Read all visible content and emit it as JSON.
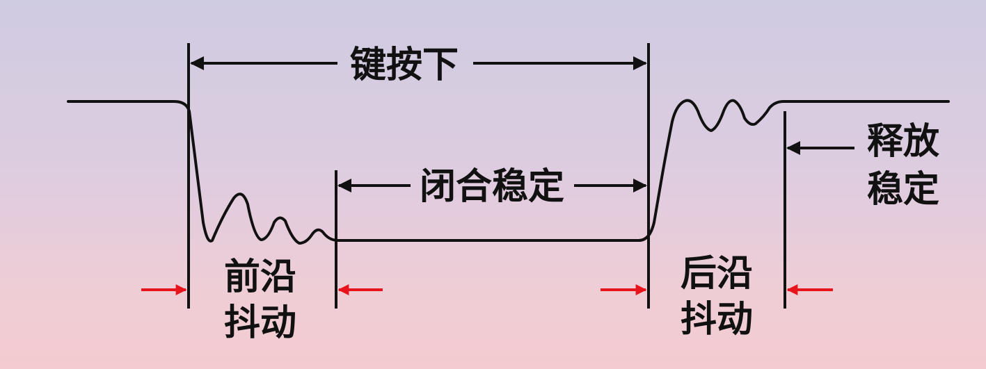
{
  "labels": {
    "key_pressed": "键按下",
    "closed_stable": "闭合稳定",
    "release_stable_line1": "释放",
    "release_stable_line2": "稳定",
    "leading_edge_line1": "前沿",
    "leading_edge_line2": "抖动",
    "trailing_edge_line1": "后沿",
    "trailing_edge_line2": "抖动"
  },
  "colors": {
    "line": "#111111",
    "marker_arrow": "#e8141b"
  }
}
